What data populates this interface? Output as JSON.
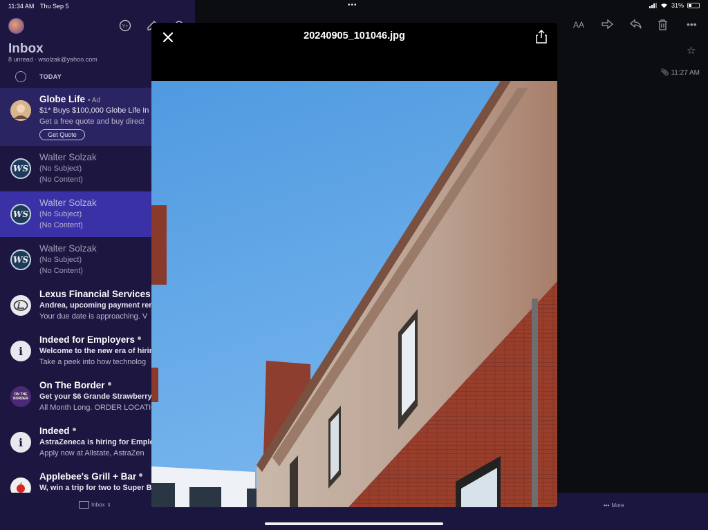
{
  "status": {
    "time": "11:34 AM",
    "date": "Thu Sep 5",
    "battery": "31%"
  },
  "inbox": {
    "title": "Inbox",
    "subtitle": "8 unread · wsolzak@yahoo.com",
    "section": "TODAY"
  },
  "messages": [
    {
      "sender": "Globe Life",
      "ad_tag": "• Ad",
      "line2": "$1* Buys $100,000 Globe Life In",
      "line3": "Get a free quote and buy direct",
      "cta": "Get Quote"
    },
    {
      "sender": "Walter Solzak",
      "line2": "(No Subject)",
      "line3": "(No Content)"
    },
    {
      "sender": "Walter Solzak",
      "line2": "(No Subject)",
      "line3": "(No Content)"
    },
    {
      "sender": "Walter Solzak",
      "line2": "(No Subject)",
      "line3": "(No Content)"
    },
    {
      "sender": "Lexus Financial Services",
      "line2": "Andrea, upcoming payment rem",
      "line3": "Your due date is approaching. V"
    },
    {
      "sender": "Indeed for Employers",
      "line2": "Welcome to the new era of hirin",
      "line3": "Take a peek into how technolog"
    },
    {
      "sender": "On The Border",
      "line2": "Get your $6 Grande Strawberry",
      "line3": "All Month Long. ORDER LOCATIO"
    },
    {
      "sender": "Indeed",
      "line2": "AstraZeneca is hiring for Emplo",
      "line3": "Apply now at Allstate, AstraZen"
    },
    {
      "sender": "Applebee's Grill + Bar",
      "line2": "W, win a trip for two to Super Bo",
      "line3": ""
    }
  ],
  "avatars": {
    "ws": "WS",
    "border": "ON THE BORDER",
    "lexus": "L",
    "info": "i"
  },
  "reader": {
    "time": "11:27 AM"
  },
  "bottombar": {
    "inbox": "Inbox",
    "more": "More"
  },
  "viewer": {
    "filename": "20240905_101046.jpg"
  }
}
